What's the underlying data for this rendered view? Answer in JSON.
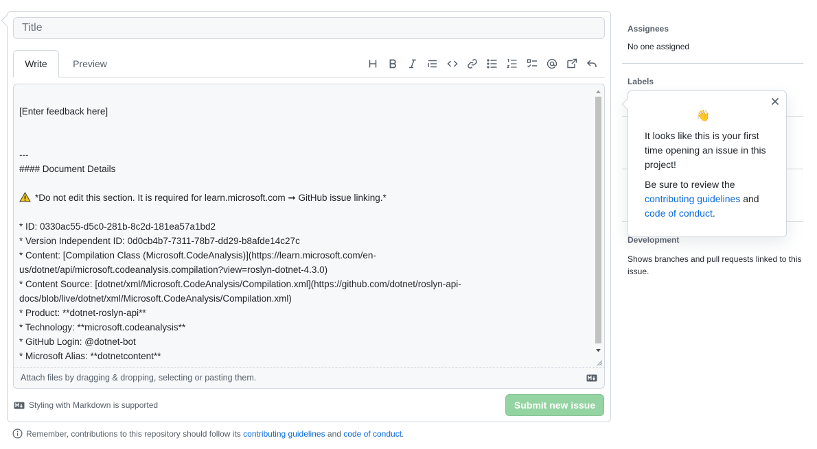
{
  "form": {
    "title_placeholder": "Title",
    "tabs": {
      "write": "Write",
      "preview": "Preview"
    },
    "toolbar": [
      {
        "name": "heading-icon"
      },
      {
        "name": "bold-icon"
      },
      {
        "name": "italic-icon"
      },
      {
        "name": "quote-icon"
      },
      {
        "name": "code-icon"
      },
      {
        "name": "link-icon"
      },
      {
        "name": "unordered-list-icon"
      },
      {
        "name": "ordered-list-icon"
      },
      {
        "name": "task-list-icon"
      },
      {
        "name": "mention-icon"
      },
      {
        "name": "cross-reference-icon"
      },
      {
        "name": "saved-replies-icon"
      }
    ],
    "body_lines": [
      "",
      "[Enter feedback here]",
      "",
      "",
      "---",
      "#### Document Details",
      "",
      "*Do not edit this section. It is required for learn.microsoft.com ➞ GitHub issue linking.*",
      "",
      "* ID: 0330ac55-d5c0-281b-8c2d-181ea57a1bd2",
      "* Version Independent ID: 0d0cb4b7-7311-78b7-dd29-b8afde14c27c",
      "* Content: [Compilation Class (Microsoft.CodeAnalysis)](https://learn.microsoft.com/en-",
      "us/dotnet/api/microsoft.codeanalysis.compilation?view=roslyn-dotnet-4.3.0)",
      "* Content Source: [dotnet/xml/Microsoft.CodeAnalysis/Compilation.xml](https://github.com/dotnet/roslyn-api-",
      "docs/blob/live/dotnet/xml/Microsoft.CodeAnalysis/Compilation.xml)",
      "* Product: **dotnet-roslyn-api**",
      "* Technology: **microsoft.codeanalysis**",
      "* GitHub Login: @dotnet-bot",
      "* Microsoft Alias: **dotnetcontent**"
    ],
    "attach_text": "Attach files by dragging & dropping, selecting or pasting them.",
    "markdown_note": "Styling with Markdown is supported",
    "submit_label": "Submit new issue"
  },
  "footer": {
    "prefix": "Remember, contributions to this repository should follow its",
    "link1": "contributing guidelines",
    "and": "and",
    "link2": "code of conduct",
    "suffix": "."
  },
  "sidebar": {
    "assignees_heading": "Assignees",
    "assignees_value": "No one assigned",
    "labels_heading": "Labels",
    "development_heading": "Development",
    "development_text_1": "Shows branches and pull requests linked to this",
    "development_text_2": "issue."
  },
  "popover": {
    "emoji": "👋",
    "line1": "It looks like this is your first",
    "line2": "time opening an issue in this",
    "line3": "project!",
    "line4": "Be sure to review the",
    "link1": "contributing guidelines",
    "and": " and",
    "link2": "code of conduct",
    "period": "."
  },
  "colors": {
    "accent_link": "#0969da",
    "submit_disabled": "#94d3a2",
    "border": "#d0d7de"
  }
}
